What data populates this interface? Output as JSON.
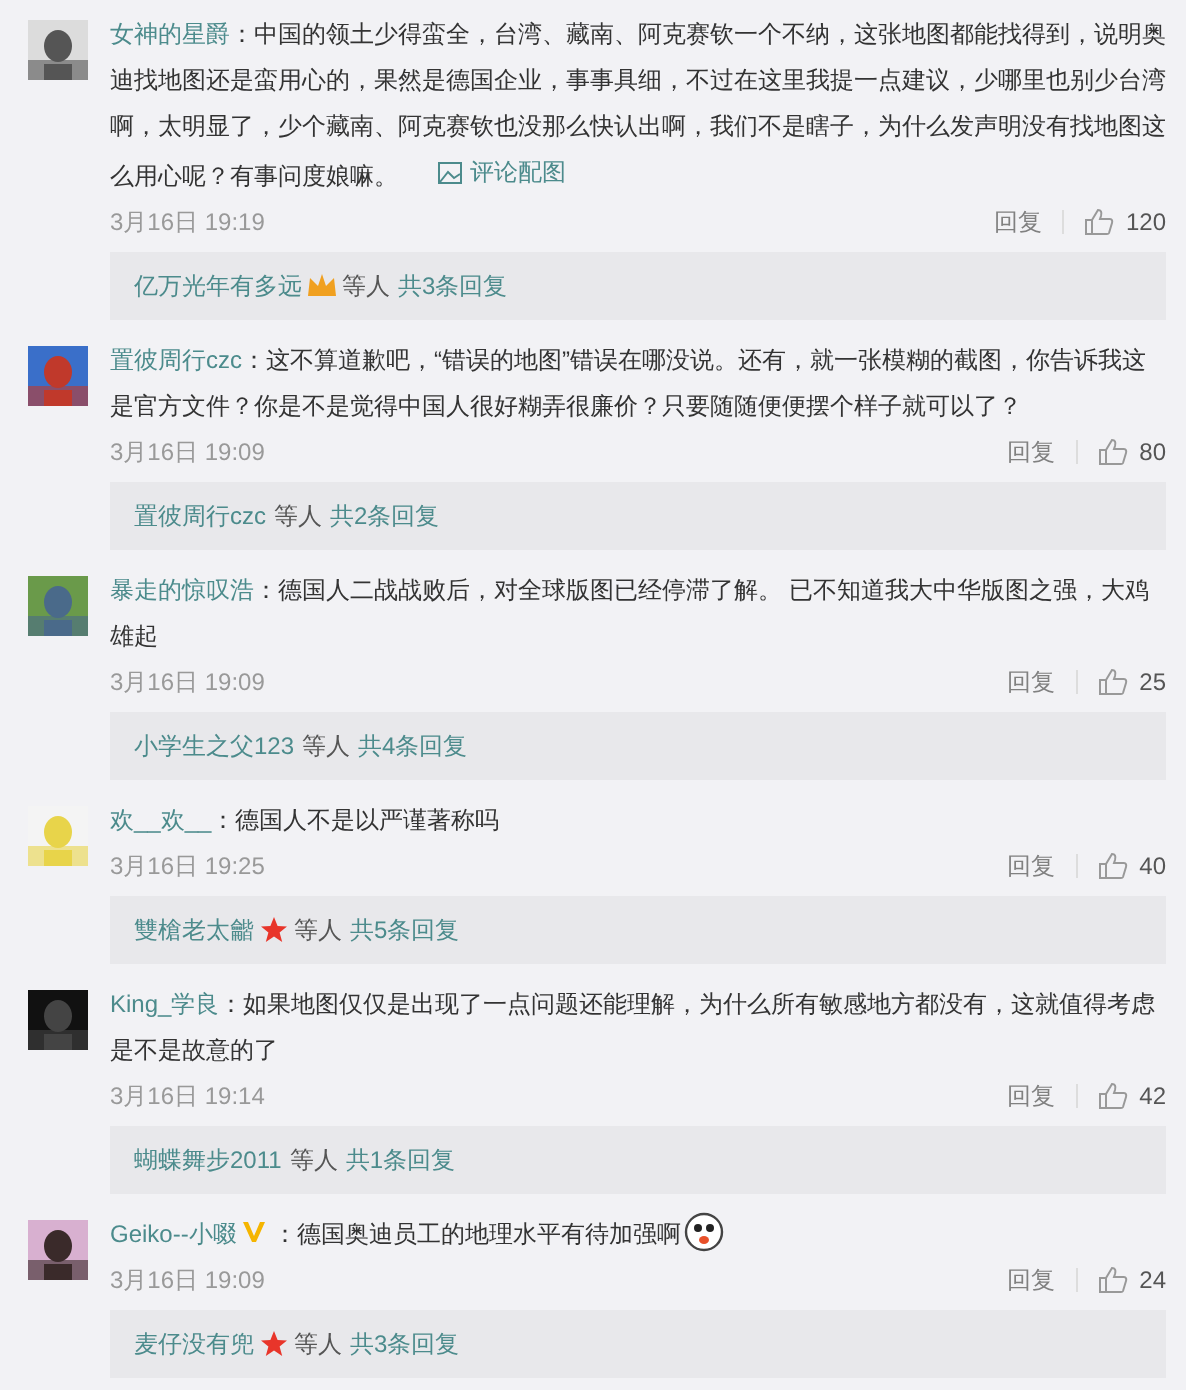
{
  "comments": [
    {
      "user": "女神的星爵",
      "text": "：中国的领土少得蛮全，台湾、藏南、阿克赛钦一个不纳，这张地图都能找得到，说明奥迪找地图还是蛮用心的，果然是德国企业，事事具细，不过在这里我提一点建议，少哪里也别少台湾啊，太明显了，少个藏南、阿克赛钦也没那么快认出啊，我们不是瞎子，为什么发声明没有找地图这么用心呢？有事问度娘嘛。",
      "image_link": "评论配图",
      "time": "3月16日 19:19",
      "reply": "回复",
      "likes": "120",
      "replies": {
        "user": "亿万光年有多远",
        "icon": {
          "kind": "crown"
        },
        "etc": "等人",
        "count": "共3条回复"
      }
    },
    {
      "user": "置彼周行czc",
      "text": "：这不算道歉吧，“错误的地图”错误在哪没说。还有，就一张模糊的截图，你告诉我这是官方文件？你是不是觉得中国人很好糊弄很廉价？只要随随便便摆个样子就可以了？",
      "time": "3月16日 19:09",
      "reply": "回复",
      "likes": "80",
      "replies": {
        "user": "置彼周行czc",
        "etc": "等人",
        "count": "共2条回复"
      }
    },
    {
      "user": "暴走的惊叹浩",
      "text": "：德国人二战战败后，对全球版图已经停滞了解。 已不知道我大中华版图之强，大鸡雄起",
      "time": "3月16日 19:09",
      "reply": "回复",
      "likes": "25",
      "replies": {
        "user": "小学生之父123",
        "etc": "等人",
        "count": "共4条回复"
      }
    },
    {
      "user": "欢__欢__",
      "text": "：德国人不是以严谨著称吗",
      "time": "3月16日 19:25",
      "reply": "回复",
      "likes": "40",
      "replies": {
        "user": "雙槍老太龤",
        "icon": {
          "kind": "star"
        },
        "etc": "等人",
        "count": "共5条回复"
      }
    },
    {
      "user": "King_学良",
      "text": "：如果地图仅仅是出现了一点问题还能理解，为什么所有敏感地方都没有，这就值得考虑是不是故意的了",
      "time": "3月16日 19:14",
      "reply": "回复",
      "likes": "42",
      "replies": {
        "user": "蝴蝶舞步2011",
        "etc": "等人",
        "count": "共1条回复"
      }
    },
    {
      "user": "Geiko--小啜",
      "verified": true,
      "text": "：德国奥迪员工的地理水平有待加强啊",
      "emoji": true,
      "time": "3月16日 19:09",
      "reply": "回复",
      "likes": "24",
      "replies": {
        "user": "麦仔没有兜",
        "icon": {
          "kind": "star"
        },
        "etc": "等人",
        "count": "共3条回复"
      }
    }
  ]
}
